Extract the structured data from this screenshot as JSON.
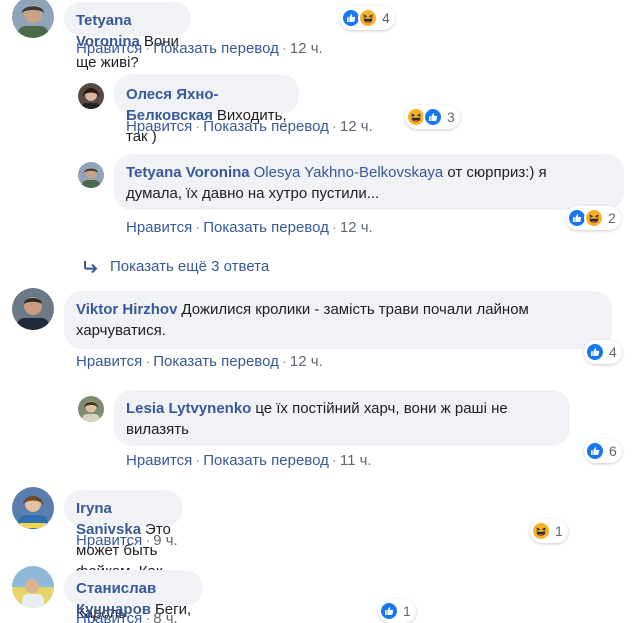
{
  "actions": {
    "like": "Нравится",
    "translate": "Показать перевод",
    "sep": "·"
  },
  "comments": [
    {
      "author": "Tetyana Voronina",
      "text": "Вони ще живі?",
      "time": "12 ч.",
      "reaction_count": "4"
    },
    {
      "author": "Олеся Яхно-Белковская",
      "text": "Виходить, так )",
      "time": "12 ч.",
      "reaction_count": "3"
    },
    {
      "author": "Tetyana Voronina",
      "mention": "Olesya Yakhno-Belkovskaya",
      "text_line1": "от сюрприз:) я",
      "text_line2": "думала, їх давно на хутро пустили...",
      "time": "12 ч.",
      "reaction_count": "2"
    },
    {
      "author": "Viktor Hirzhov",
      "text_line1": "Дожилися кролики - замість трави почали лайном",
      "text_line2": "харчуватися.",
      "time": "12 ч.",
      "reaction_count": "4"
    },
    {
      "author": "Lesia Lytvynenko",
      "text_line1": "це їх постійний харч, вони ж раші не",
      "text_line2": "вилазять",
      "time": "11 ч.",
      "reaction_count": "6"
    },
    {
      "author": "Iryna Sanivska",
      "text": "Это может быть фейком. Как с Тиной Кароль.",
      "time": "9 ч.",
      "reaction_count": "1"
    },
    {
      "author": "Станислав Кушнаров",
      "text": "Беги, кролик, беги!",
      "time": "8 ч.",
      "reaction_count": "1"
    }
  ],
  "more_replies": "Показать ещё 3 ответа",
  "colors": {
    "link": "#385898",
    "bubble": "#f0f2f5",
    "like": "#1877f2",
    "haha": "#f7b125"
  }
}
